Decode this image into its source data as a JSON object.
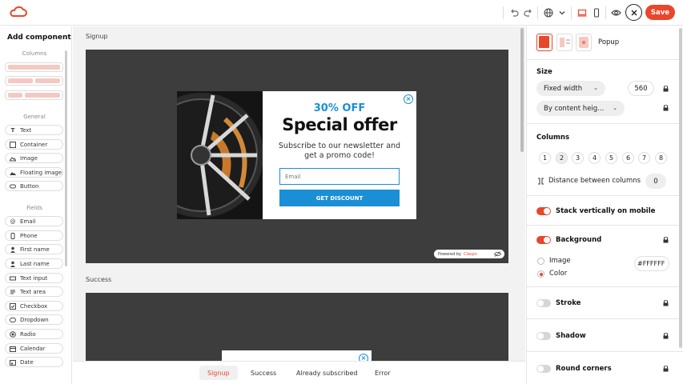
{
  "toolbar": {
    "save_label": "Save",
    "icons": [
      "logo-icon",
      "undo-icon",
      "redo-icon",
      "globe-icon",
      "chevron-down-icon",
      "desktop-icon",
      "mobile-icon",
      "eye-icon",
      "close-icon"
    ]
  },
  "left_panel": {
    "title": "Add component",
    "columns_label": "Columns",
    "general_label": "General",
    "general_items": [
      {
        "label": "Text",
        "icon": "text-icon"
      },
      {
        "label": "Container",
        "icon": "container-icon"
      },
      {
        "label": "Image",
        "icon": "image-icon"
      },
      {
        "label": "Floating image",
        "icon": "floating-image-icon"
      },
      {
        "label": "Button",
        "icon": "button-icon"
      }
    ],
    "fields_label": "Fields",
    "field_items": [
      {
        "label": "Email",
        "icon": "at-icon"
      },
      {
        "label": "Phone",
        "icon": "phone-icon"
      },
      {
        "label": "First name",
        "icon": "user-icon"
      },
      {
        "label": "Last name",
        "icon": "user-icon"
      },
      {
        "label": "Text input",
        "icon": "input-icon"
      },
      {
        "label": "Text area",
        "icon": "textarea-icon"
      },
      {
        "label": "Checkbox",
        "icon": "checkbox-icon"
      },
      {
        "label": "Dropdown",
        "icon": "dropdown-icon"
      },
      {
        "label": "Radio",
        "icon": "radio-icon"
      },
      {
        "label": "Calendar",
        "icon": "calendar-icon"
      },
      {
        "label": "Date",
        "icon": "date-icon"
      }
    ]
  },
  "canvas": {
    "signup_label": "Signup",
    "success_label": "Success",
    "popup": {
      "discount": "30% OFF",
      "offer": "Special offer",
      "subtitle": "Subscribe to our newsletter and get a promo code!",
      "email_placeholder": "Email",
      "button_label": "GET DISCOUNT",
      "close_glyph": "×"
    },
    "powered_by": "Powered by",
    "powered_brand": "Claspo",
    "tabs": [
      {
        "label": "Signup",
        "active": true
      },
      {
        "label": "Success",
        "active": false
      },
      {
        "label": "Already subscribed",
        "active": false
      },
      {
        "label": "Error",
        "active": false
      }
    ]
  },
  "right_panel": {
    "type_label": "Popup",
    "size_heading": "Size",
    "width_mode": "Fixed width",
    "width_value": "560",
    "height_mode": "By content heig...",
    "columns_heading": "Columns",
    "column_options": [
      "1",
      "2",
      "3",
      "4",
      "5",
      "6",
      "7",
      "8"
    ],
    "selected_columns": "2",
    "distance_label": "Distance between columns",
    "distance_value": "0",
    "stack_label": "Stack vertically on mobile",
    "background_label": "Background",
    "bg_image_label": "Image",
    "bg_color_label": "Color",
    "bg_color_value": "#FFFFFF",
    "stroke_label": "Stroke",
    "shadow_label": "Shadow",
    "round_corners_label": "Round corners"
  },
  "colors": {
    "accent": "#e8472b",
    "popup_blue": "#1a8fd6",
    "canvas_dark": "#3d3d3d"
  }
}
